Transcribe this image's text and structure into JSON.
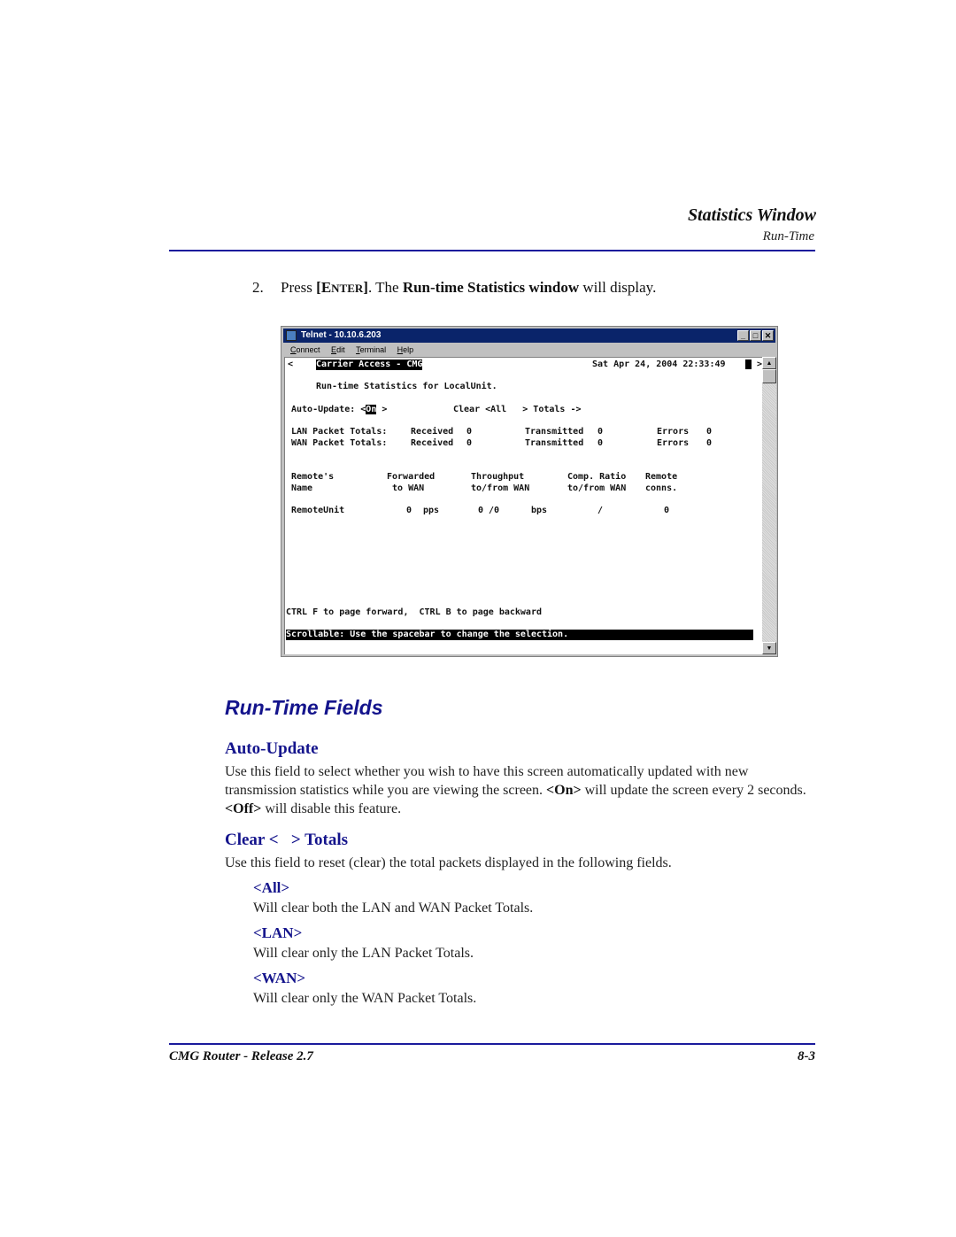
{
  "header": {
    "chapter_title": "Statistics Window",
    "section_title": "Run-Time"
  },
  "step": {
    "number": "2.",
    "press": "Press ",
    "key_open": "[E",
    "key_small": "NTER",
    "key_close": "]",
    "mid": ". The ",
    "bold": "Run-time Statistics window",
    "end": " will display."
  },
  "telnet": {
    "title": "Telnet - 10.10.6.203",
    "menu": [
      {
        "hot": "C",
        "rest": "onnect"
      },
      {
        "hot": "E",
        "rest": "dit"
      },
      {
        "hot": "T",
        "rest": "erminal"
      },
      {
        "hot": "H",
        "rest": "elp"
      }
    ],
    "buttons": {
      "minimize": "_",
      "maximize": "□",
      "close": "✕"
    },
    "scroll_up": "▲",
    "scroll_down": "▼",
    "screen": {
      "nav_left": "<",
      "nav_right": ">",
      "banner": "Carrier Access - CMG",
      "datetime": "Sat Apr 24, 2004 22:33:49",
      "heading": "Run-time Statistics for LocalUnit.",
      "auto_update_label": "Auto-Update: <",
      "auto_update_value": "On",
      "auto_update_close": " >",
      "clear_label": "Clear <All   > Totals ->",
      "lan_label": "LAN Packet Totals:",
      "wan_label": "WAN Packet Totals:",
      "received_label": "Received",
      "transmitted_label": "Transmitted",
      "errors_label": "Errors",
      "lan_received": "0",
      "lan_transmitted": "0",
      "lan_errors": "0",
      "wan_received": "0",
      "wan_transmitted": "0",
      "wan_errors": "0",
      "table_headers": [
        [
          "Remote's",
          "Name"
        ],
        [
          "Forwarded",
          " to WAN"
        ],
        [
          "Throughput",
          "to/from WAN"
        ],
        [
          "Comp. Ratio",
          "to/from WAN"
        ],
        [
          "Remote",
          "conns."
        ]
      ],
      "rows": [
        {
          "name": "RemoteUnit",
          "forwarded": "0",
          "forwarded_unit": "pps",
          "throughput": "0 /0",
          "throughput_unit": "bps",
          "comp_ratio": "/",
          "conns": "0"
        }
      ],
      "paging_hint": "CTRL F to page forward,  CTRL B to page backward",
      "status_line": "Scrollable: Use the spacebar to change the selection."
    }
  },
  "section": {
    "title": "Run-Time Fields",
    "auto_update": {
      "heading": "Auto-Update",
      "text_1": "Use this field to select whether you wish to have this screen automatically updated with new transmission statistics while you are viewing the screen. ",
      "on": "<On>",
      "text_2": " will update the screen every 2 seconds. ",
      "off": "<Off>",
      "text_3": " will disable this feature."
    },
    "clear_totals": {
      "heading": "Clear <   > Totals",
      "text": "Use this field to reset (clear) the total packets displayed in the following fields.",
      "options": [
        {
          "label": "<All>",
          "desc": "Will clear both the LAN and WAN Packet Totals."
        },
        {
          "label": "<LAN>",
          "desc": "Will clear only the LAN Packet Totals."
        },
        {
          "label": "<WAN>",
          "desc": "Will clear only the WAN Packet Totals."
        }
      ]
    }
  },
  "footer": {
    "left": "CMG Router - Release 2.7",
    "right": "8-3"
  }
}
